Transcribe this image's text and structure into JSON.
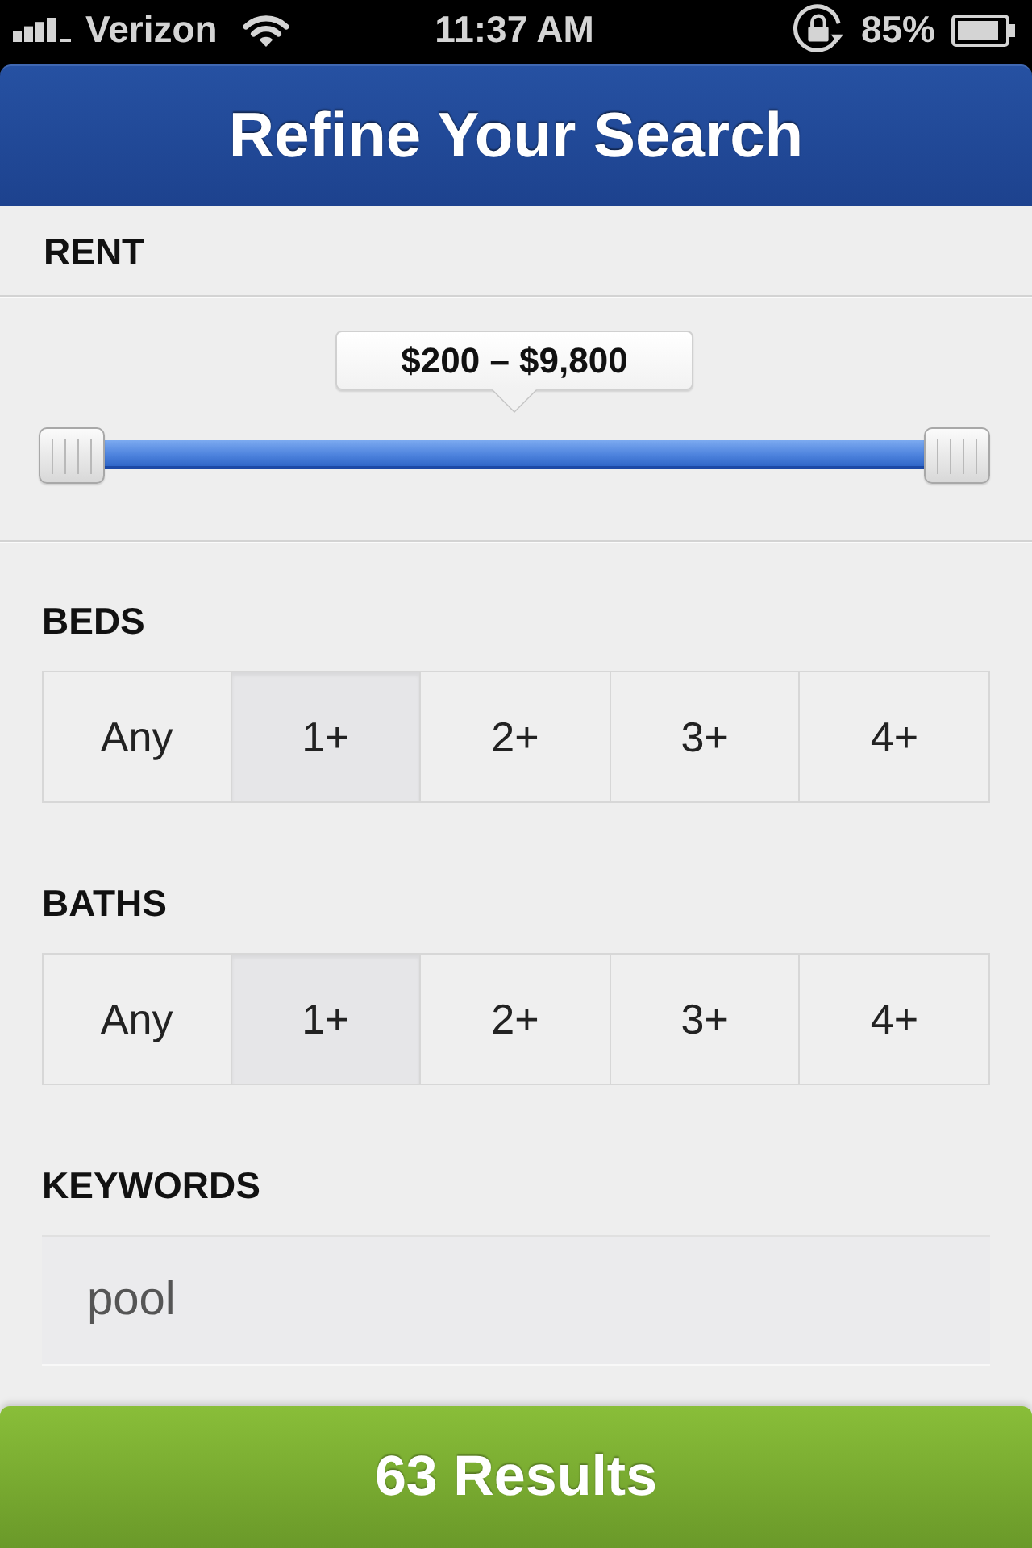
{
  "status_bar": {
    "carrier": "Verizon",
    "time": "11:37 AM",
    "battery": "85%"
  },
  "header": {
    "title": "Refine Your Search"
  },
  "rent": {
    "label": "RENT",
    "range_label": "$200 – $9,800",
    "handles": [
      {
        "level": 0
      },
      {
        "level": 1
      }
    ]
  },
  "filters": [
    {
      "label": "BEDS",
      "options": [
        {
          "label": "Any",
          "selected": false
        },
        {
          "label": "1+",
          "selected": true
        },
        {
          "label": "2+",
          "selected": false
        },
        {
          "label": "3+",
          "selected": false
        },
        {
          "label": "4+",
          "selected": false
        }
      ]
    },
    {
      "label": "BATHS",
      "options": [
        {
          "label": "Any",
          "selected": false
        },
        {
          "label": "1+",
          "selected": true
        },
        {
          "label": "2+",
          "selected": false
        },
        {
          "label": "3+",
          "selected": false
        },
        {
          "label": "4+",
          "selected": false
        }
      ]
    }
  ],
  "keywords": {
    "label": "KEYWORDS",
    "value": "pool"
  },
  "results_button": {
    "label": "63 Results"
  }
}
